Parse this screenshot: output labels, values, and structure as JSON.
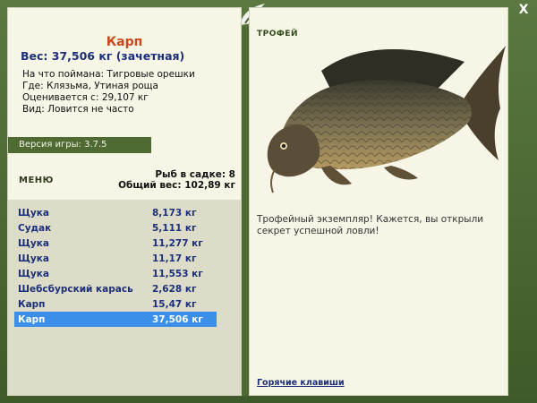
{
  "window": {
    "close_label": "X",
    "accent": "#c8491d",
    "panel_color": "#f6f5e6"
  },
  "fish": {
    "name": "Карп",
    "weight_line": "Вес: 37,506 кг (зачетная)",
    "details": [
      "На что поймана: Тигровые орешки",
      "Где: Клязьма, Утиная роща",
      "Оценивается с: 29,107 кг",
      "Вид: Ловится не часто"
    ]
  },
  "version": "Версия игры: 3.7.5",
  "menu_label": "МЕНЮ",
  "stats": {
    "count": "Рыб в садке: 8",
    "total": "Общий вес: 102,89 кг"
  },
  "list": [
    {
      "name": "Щука",
      "weight": "8,173 кг"
    },
    {
      "name": "Судак",
      "weight": "5,111 кг"
    },
    {
      "name": "Щука",
      "weight": "11,277 кг"
    },
    {
      "name": "Щука",
      "weight": "11,17 кг"
    },
    {
      "name": "Щука",
      "weight": "11,553 кг"
    },
    {
      "name": "Шебсбурский карась",
      "weight": "2,628 кг"
    },
    {
      "name": "Карп",
      "weight": "15,47 кг"
    },
    {
      "name": "Карп",
      "weight": "37,506 кг",
      "selected": true
    }
  ],
  "trophy": {
    "label": "ТРОФЕЙ",
    "text": "Трофейный экземпляр! Кажется, вы открыли секрет успешной ловли!"
  },
  "hotkeys_label": "Горячие клавиши"
}
